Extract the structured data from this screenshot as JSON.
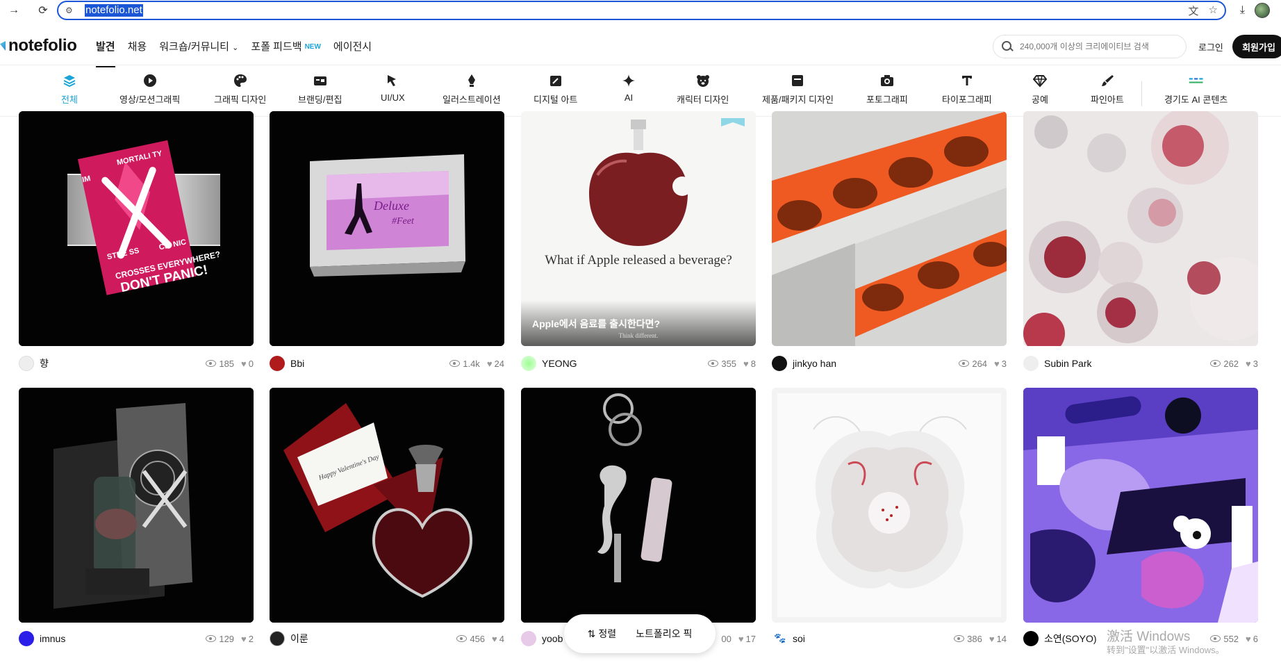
{
  "browser": {
    "url": "notefolio.net"
  },
  "nav": {
    "logo": "notefolio",
    "items": [
      {
        "label": "발견"
      },
      {
        "label": "채용"
      },
      {
        "label": "워크숍/커뮤니티"
      },
      {
        "label": "포폴 피드백"
      },
      {
        "label": "에이전시"
      }
    ],
    "new_badge": "NEW",
    "search_placeholder": "240,000개 이상의 크리에이티브 검색",
    "login": "로그인",
    "signup": "회원가입"
  },
  "categories": [
    {
      "label": "전체",
      "icon": "layers-icon"
    },
    {
      "label": "영상/모션그래픽",
      "icon": "play-icon"
    },
    {
      "label": "그래픽 디자인",
      "icon": "palette-icon"
    },
    {
      "label": "브랜딩/편집",
      "icon": "card-icon"
    },
    {
      "label": "UI/UX",
      "icon": "cursor-icon"
    },
    {
      "label": "일러스트레이션",
      "icon": "pen-nib-icon"
    },
    {
      "label": "디지털 아트",
      "icon": "tablet-icon"
    },
    {
      "label": "AI",
      "icon": "sparkle-icon"
    },
    {
      "label": "캐릭터 디자인",
      "icon": "bear-icon"
    },
    {
      "label": "제품/패키지 디자인",
      "icon": "box-icon"
    },
    {
      "label": "포토그래피",
      "icon": "camera-icon"
    },
    {
      "label": "타이포그래피",
      "icon": "type-icon"
    },
    {
      "label": "공예",
      "icon": "gem-icon"
    },
    {
      "label": "파인아트",
      "icon": "brush-icon"
    },
    {
      "label": "경기도 AI 콘텐츠",
      "icon": "gyeonggi-logo-icon"
    }
  ],
  "cards": [
    {
      "author": "향",
      "views": "185",
      "likes": "0",
      "avatar_color": "#eeeeee",
      "poster_text": "CROSSES EVERYWHERE? DON'T PANIC!"
    },
    {
      "author": "Bbi",
      "views": "1.4k",
      "likes": "24",
      "avatar_color": "#b01c1c"
    },
    {
      "author": "YEONG",
      "views": "355",
      "likes": "8",
      "avatar_color": "#7ef07a",
      "title_line": "What if Apple released a beverage?",
      "caption": "Apple에서 음료를 출시한다면?",
      "sub_caption": "Think different."
    },
    {
      "author": "jinkyo han",
      "views": "264",
      "likes": "3",
      "avatar_color": "#111111"
    },
    {
      "author": "Subin Park",
      "views": "262",
      "likes": "3",
      "avatar_color": "#eeeeee"
    },
    {
      "author": "imnus",
      "views": "129",
      "likes": "2",
      "avatar_color": "#2a1ee8"
    },
    {
      "author": "이룬",
      "views": "456",
      "likes": "4",
      "avatar_color": "#222222"
    },
    {
      "author": "yoob",
      "views": "00",
      "likes": "17",
      "avatar_color": "#e7c9e8"
    },
    {
      "author": "soi",
      "views": "386",
      "likes": "14",
      "avatar_color": "#ffffff"
    },
    {
      "author": "소연(SOYO)",
      "views": "552",
      "likes": "6",
      "avatar_color": "#000000"
    }
  ],
  "floating": {
    "sort": "정렬",
    "pick": "노트폴리오 픽"
  },
  "watermark": {
    "line1": "激活 Windows",
    "line2": "转到\"设置\"以激活 Windows。"
  }
}
